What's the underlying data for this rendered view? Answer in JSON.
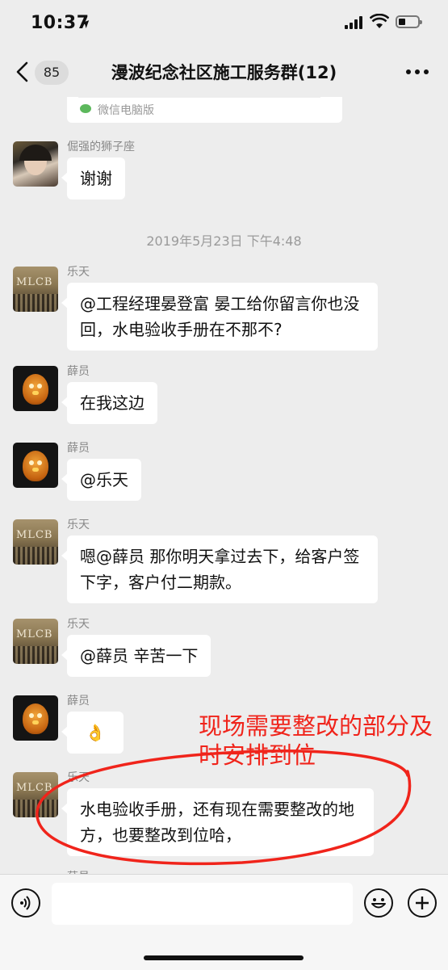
{
  "status_bar": {
    "time": "10:37",
    "location_arrow": "➤"
  },
  "nav": {
    "unread_count": "85",
    "title": "漫波纪念社区施工服务群(12)"
  },
  "chat": {
    "partial_card": {
      "source": "微信电脑版"
    },
    "messages": [
      {
        "sender": "倔强的狮子座",
        "text": "谢谢",
        "avatar": "lion"
      },
      {
        "timestamp": "2019年5月23日 下午4:48"
      },
      {
        "sender": "乐天",
        "text": "@工程经理晏登富 晏工给你留言你也没回，水电验收手册在不那不?",
        "avatar": "mlcb"
      },
      {
        "sender": "薛员",
        "text": "在我这边",
        "avatar": "chick"
      },
      {
        "sender": "薛员",
        "text": "@乐天",
        "avatar": "chick"
      },
      {
        "sender": "乐天",
        "text": "嗯@薛员 那你明天拿过去下，给客户签下字，客户付二期款。",
        "avatar": "mlcb"
      },
      {
        "sender": "乐天",
        "text": "@薛员 辛苦一下",
        "avatar": "mlcb"
      },
      {
        "sender": "薛员",
        "text": "👌",
        "avatar": "chick"
      },
      {
        "sender": "乐天",
        "text": "水电验收手册，还有现在需要整改的地方，也要整改到位哈，",
        "avatar": "mlcb"
      },
      {
        "sender": "薛员"
      }
    ],
    "avatar_text": "MLCB"
  },
  "annotation": {
    "text": "现场需要整改的部分及时安排到位",
    "color": "#f0241b"
  },
  "input_bar": {
    "voice_icon": "voice-icon",
    "emoji_icon": "emoji-icon",
    "plus_icon": "plus-icon"
  }
}
